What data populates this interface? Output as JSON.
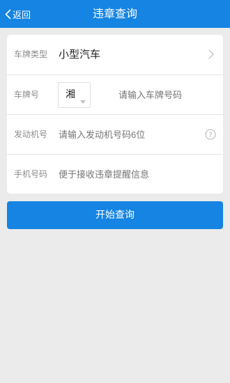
{
  "header": {
    "back_label": "返回",
    "title": "违章查询",
    "background": "#1584e2"
  },
  "form": {
    "car_type": {
      "label": "车牌类型",
      "value": "小型汽车",
      "icon": "chevron-right-icon"
    },
    "plate": {
      "label": "车牌号",
      "province": "湘",
      "placeholder": "请输入车牌号码"
    },
    "engine": {
      "label": "发动机号",
      "placeholder": "请输入发动机号码6位",
      "icon": "help-icon"
    },
    "phone": {
      "label": "手机号码",
      "placeholder": "便于接收违章提醒信息"
    }
  },
  "submit": {
    "label": "开始查询",
    "background": "#1584e2"
  }
}
